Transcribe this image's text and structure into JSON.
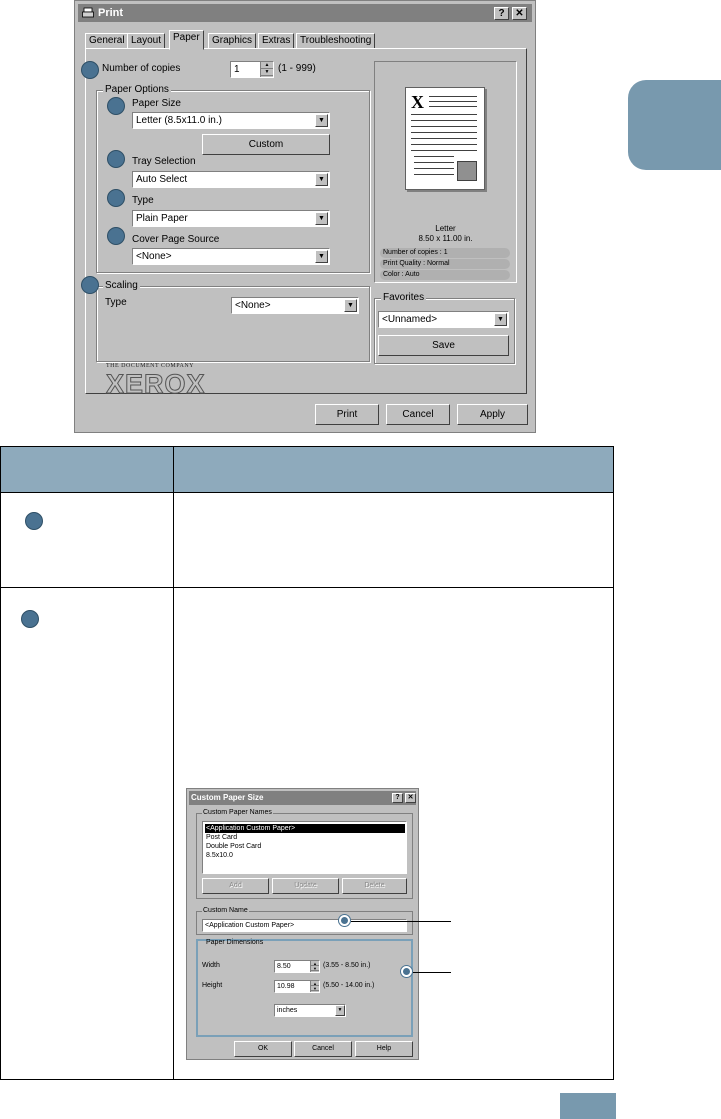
{
  "print_dialog": {
    "title": "Print",
    "help_button": "?",
    "close_button": "✕",
    "tabs": [
      "General",
      "Layout",
      "Paper",
      "Graphics",
      "Extras",
      "Troubleshooting"
    ],
    "active_tab": "Paper",
    "copies": {
      "label": "Number of copies",
      "value": "1",
      "range": "(1 - 999)"
    },
    "paper_options": {
      "group_title": "Paper Options",
      "paper_size_label": "Paper Size",
      "paper_size_value": "Letter (8.5x11.0 in.)",
      "custom_button": "Custom",
      "tray_label": "Tray Selection",
      "tray_value": "Auto Select",
      "type_label": "Type",
      "type_value": "Plain Paper",
      "cover_label": "Cover Page Source",
      "cover_value": "<None>"
    },
    "scaling": {
      "group_title": "Scaling",
      "type_label": "Type",
      "type_value": "<None>"
    },
    "preview": {
      "page_letter": "X",
      "size_name": "Letter",
      "size_dims": "8.50 x 11.00 in.",
      "info": [
        "Number of copies : 1",
        "Print Quality : Normal",
        "Color : Auto"
      ]
    },
    "favorites": {
      "group_title": "Favorites",
      "value": "<Unnamed>",
      "save_button": "Save"
    },
    "brand": {
      "tagline": "THE DOCUMENT COMPANY",
      "logo": "XEROX"
    },
    "buttons": {
      "print": "Print",
      "cancel": "Cancel",
      "apply": "Apply"
    }
  },
  "custom_dialog": {
    "title": "Custom Paper Size",
    "help_button": "?",
    "close_button": "✕",
    "names_group": "Custom Paper Names",
    "names_list": [
      "<Application Custom Paper>",
      "Post Card",
      "Double Post Card",
      "8.5x10.0"
    ],
    "add_button": "Add",
    "update_button": "Update",
    "delete_button": "Delete",
    "custom_name_group": "Custom Name",
    "custom_name_value": "<Application Custom Paper>",
    "dimensions_group": "Paper Dimensions",
    "width_label": "Width",
    "width_value": "8.50",
    "width_range": "(3.55 - 8.50 in.)",
    "height_label": "Height",
    "height_value": "10.98",
    "height_range": "(5.50 - 14.00 in.)",
    "units_value": "inches",
    "ok_button": "OK",
    "cancel_button": "Cancel",
    "help_text_button": "Help"
  },
  "colors": {
    "callout": "#4a7291",
    "accent_tab": "#7899ae",
    "table_header": "#8eaabc",
    "dialog_face": "#c0c0c0"
  }
}
